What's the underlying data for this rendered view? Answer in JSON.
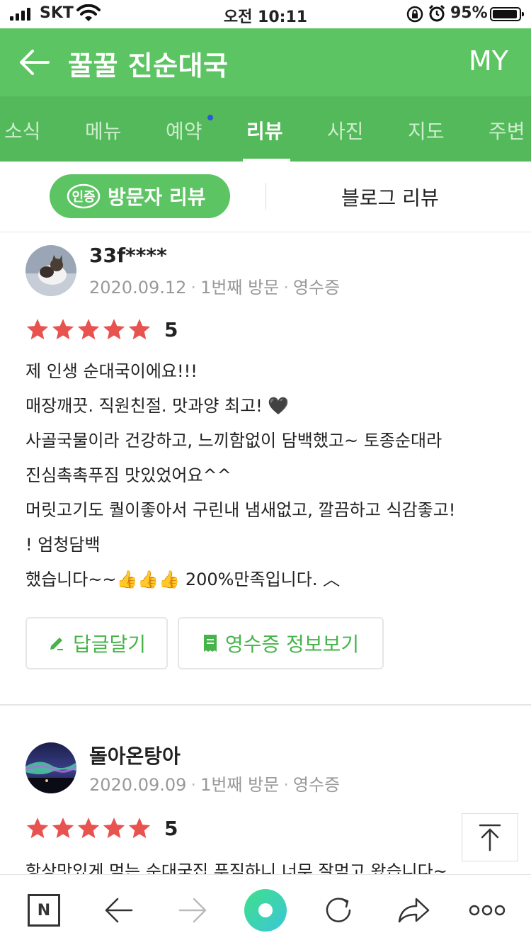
{
  "status_bar": {
    "carrier": "SKT",
    "time": "오전 10:11",
    "battery": "95%"
  },
  "header": {
    "title": "꿀꿀 진순대국",
    "my_label": "MY"
  },
  "tabs": [
    {
      "label": "소식"
    },
    {
      "label": "메뉴"
    },
    {
      "label": "예약"
    },
    {
      "label": "리뷰"
    },
    {
      "label": "사진"
    },
    {
      "label": "지도"
    },
    {
      "label": "주변"
    }
  ],
  "subtabs": {
    "badge": "인증",
    "visitor": "방문자 리뷰",
    "blog": "블로그 리뷰"
  },
  "reviews": [
    {
      "user": "33f****",
      "date": "2020.09.12",
      "visit": "1번째 방문",
      "receipt": "영수증",
      "rating": 5,
      "rating_label": "5",
      "text_lines": [
        "제 인생 순대국이에요!!!",
        "매장깨끗. 직원친절. 맛과양 최고! 🖤",
        "사골국물이라 건강하고, 느끼함없이 담백했고~ 토종순대라",
        "진심촉촉푸짐 맛있었어요^^",
        "머릿고기도 퀄이좋아서 구린내 냄새없고, 깔끔하고 식감좋고!",
        "! 엄청담백",
        "했습니다~~👍👍👍 200%만족입니다. ︿"
      ],
      "reply_button": "답글달기",
      "receipt_button": "영수증 정보보기"
    },
    {
      "user": "돌아온탕아",
      "date": "2020.09.09",
      "visit": "1번째 방문",
      "receipt": "영수증",
      "rating": 5,
      "rating_label": "5",
      "text_lines": [
        "항상맛있게 먹는 순대국집 푸짐하니 너무 잘먹고 왔습니다~"
      ]
    }
  ],
  "colors": {
    "brand_green": "#5cc462",
    "tab_bar_green": "#54b95a",
    "star_red": "#e8524f",
    "action_green": "#45b449"
  },
  "toolbar": {
    "home_label": "N"
  }
}
